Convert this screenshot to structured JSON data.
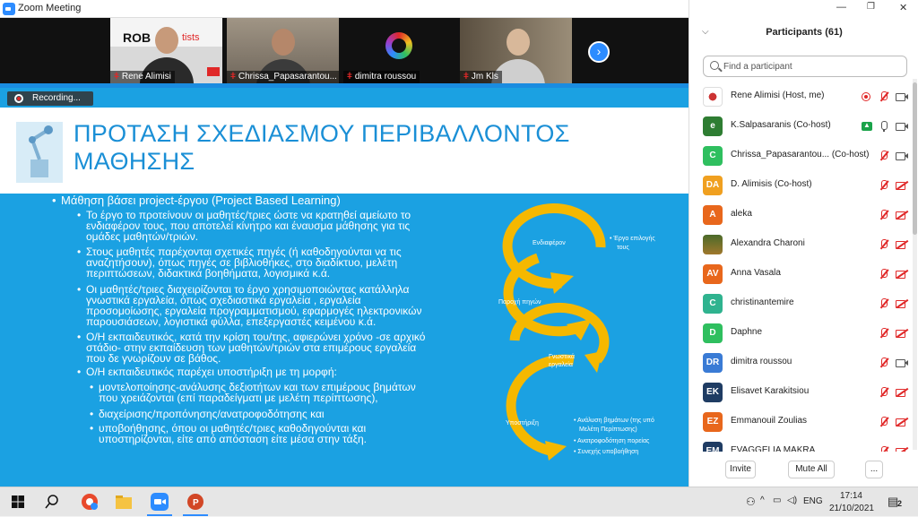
{
  "window": {
    "title": "Zoom Meeting"
  },
  "gallery": {
    "tiles": [
      {
        "name": "Rene Alimisi",
        "overlay": "ROB",
        "overlay2": "tists"
      },
      {
        "name": "Chrissa_Papasarantou..."
      },
      {
        "name": "dimitra roussou"
      },
      {
        "name": "Jm Kls"
      }
    ]
  },
  "recording": {
    "label": "Recording..."
  },
  "slide": {
    "title_line1": "ΠΡΟΤΑΣΗ ΣΧΕΔΙΑΣΜΟΥ ΠΕΡΙΒΑΛΛΟΝΤΟΣ",
    "title_line2": "ΜΑΘΗΣΗΣ",
    "main_bullet": "Μάθηση βάσει project-έργου (Project Based Learning)",
    "b1": [
      "Το έργο το προτείνουν οι μαθητές/τριες ώστε να κρατηθεί αμείωτο το",
      "ενδιαφέρον τους, που αποτελεί κίνητρο και έναυσμα μάθησης για τις",
      "ομάδες μαθητών/τριών."
    ],
    "b2": [
      "Στους μαθητές παρέχονται σχετικές πηγές (ή καθοδηγούνται να τις",
      "αναζητήσουν), όπως πηγές σε βιβλιοθήκες, στο διαδίκτυο, μελέτη",
      "περιπτώσεων, διδακτικά βοηθήματα, λογισμικά κ.ά."
    ],
    "b3": [
      "Οι μαθητές/τριες διαχειρίζονται το έργο χρησιμοποιώντας κατάλληλα",
      "γνωστικά εργαλεία, όπως σχεδιαστικά εργαλεία , εργαλεία",
      "προσομοίωσης, εργαλεία προγραμματισμού, εφαρμογές ηλεκτρονικών",
      "παρουσιάσεων, λογιστικά φύλλα, επεξεργαστές κειμένου κ.ά."
    ],
    "b4": [
      "Ο/Η εκπαιδευτικός, κατά την κρίση του/της, αφιερώνει χρόνο -σε αρχικό",
      "στάδιο- στην εκπαίδευση των μαθητών/τριών στα επιμέρους εργαλεία",
      "που δε γνωρίζουν σε βάθος."
    ],
    "b5": [
      "Ο/Η εκπαιδευτικός παρέχει υποστήριξη με τη μορφή:"
    ],
    "s1": [
      "μοντελοποίησης-ανάλυσης δεξιοτήτων και των επιμέρους βημάτων",
      "που χρειάζονται (επί παραδείγματι με μελέτη περίπτωσης),"
    ],
    "s2": [
      "διαχείρισης/προπόνησης/ανατροφοδότησης και"
    ],
    "s3": [
      "υποβοήθησης, όπου οι μαθητές/τριες καθοδηγούνται και",
      "υποστηρίζονται, είτε από απόσταση είτε μέσα στην τάξη."
    ],
    "cycle": {
      "stage1": "Ενδιαφέρον",
      "stage2": "Παροχή πηγών",
      "stage3a": "Γνωστικά",
      "stage3b": "εργαλεία",
      "stage4": "Υποστήριξη",
      "note1a": "• Έργο επιλογής",
      "note1b": "τους",
      "note4": [
        "• Ανάλυση βημάτων (της υπό",
        "Μελέτη Περίπτωσης)",
        "• Ανατροφοδότηση πορείας",
        "• Συνεχής υποβοήθηση"
      ]
    }
  },
  "participants_panel": {
    "title": "Participants (61)",
    "search_placeholder": "Find a participant",
    "list": [
      {
        "initials": "",
        "name": "Rene Alimisi (Host, me)",
        "color": "#ffffff",
        "icons": [
          "rec",
          "mic-muted",
          "cam-on"
        ]
      },
      {
        "initials": "e",
        "name": "K.Salpasaranis (Co-host)",
        "color": "#2e7d32",
        "icons": [
          "share",
          "mic-on",
          "cam-on"
        ]
      },
      {
        "initials": "C",
        "name": "Chrissa_Papasarantou... (Co-host)",
        "color": "#2fbf5f",
        "icons": [
          "mic-muted",
          "cam-on"
        ]
      },
      {
        "initials": "DA",
        "name": "D. Alimisis (Co-host)",
        "color": "#f0a020",
        "icons": [
          "mic-muted",
          "cam-off"
        ]
      },
      {
        "initials": "A",
        "name": "aleka",
        "color": "#e8671c",
        "icons": [
          "mic-muted",
          "cam-off"
        ]
      },
      {
        "initials": "",
        "name": "Alexandra Charoni",
        "color": "#6b4e2e",
        "icons": [
          "mic-muted",
          "cam-off"
        ]
      },
      {
        "initials": "AV",
        "name": "Anna Vasala",
        "color": "#e8671c",
        "icons": [
          "mic-muted",
          "cam-off"
        ]
      },
      {
        "initials": "C",
        "name": "christinantemire",
        "color": "#2fb38f",
        "icons": [
          "mic-muted",
          "cam-off"
        ]
      },
      {
        "initials": "D",
        "name": "Daphne",
        "color": "#2fbf5f",
        "icons": [
          "mic-muted",
          "cam-off"
        ]
      },
      {
        "initials": "DR",
        "name": "dimitra roussou",
        "color": "#3a7bd5",
        "icons": [
          "mic-muted",
          "cam-on"
        ]
      },
      {
        "initials": "EK",
        "name": "Elisavet Karakitsiou",
        "color": "#1f3c63",
        "icons": [
          "mic-muted",
          "cam-off"
        ]
      },
      {
        "initials": "EZ",
        "name": "Emmanouil Zoulias",
        "color": "#e8671c",
        "icons": [
          "mic-muted",
          "cam-off"
        ]
      },
      {
        "initials": "EM",
        "name": "EVAGGELIA MAKRA",
        "color": "#1f3c63",
        "icons": [
          "mic-muted",
          "cam-off"
        ]
      }
    ],
    "buttons": {
      "invite": "Invite",
      "mute_all": "Mute All",
      "more": "..."
    }
  },
  "taskbar": {
    "language": "ENG",
    "time": "17:14",
    "date": "21/10/2021",
    "notifications": "2"
  }
}
